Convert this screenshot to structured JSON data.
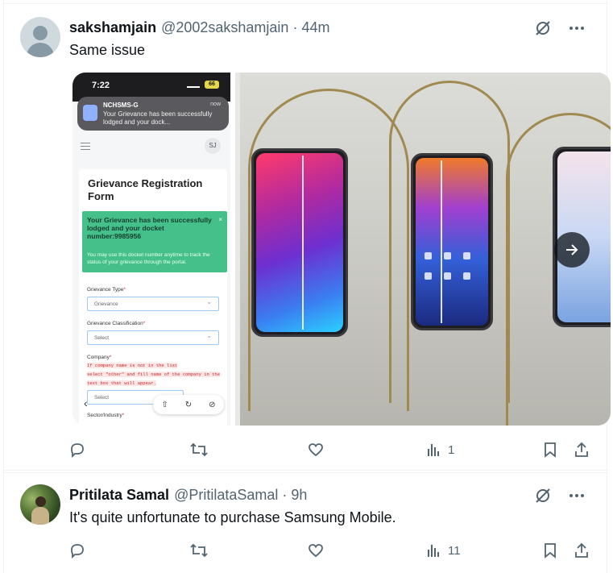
{
  "tweets": [
    {
      "display_name": "sakshamjain",
      "handle": "@2002sakshamjain",
      "separator": "·",
      "time": "44m",
      "text": "Same issue",
      "media": {
        "screenshot": {
          "clock": "7:22",
          "battery": "66",
          "notification": {
            "app": "NCHSMS-G",
            "when": "now",
            "message": "Your Grievance has been successfully lodged and your dock..."
          },
          "avatar_initials": "SJ",
          "form_title": "Grievance Registration Form",
          "success_title": "Your Grievance has been successfully lodged and your docket number:9985956",
          "success_note": "You may use this docket number anytime to track the status of your grievance through the portal.",
          "close": "×",
          "fields": [
            {
              "label": "Grievance Type",
              "value": "Grievance"
            },
            {
              "label": "Grievance Classification",
              "value": "Select"
            },
            {
              "label": "Company",
              "value": "Select"
            },
            {
              "label": "Sector/Industry",
              "value": ""
            }
          ],
          "company_hint_1": "If company name is not in the list",
          "company_hint_2": "select \"other\" and fill name of the company in the",
          "company_hint_3": "text box that will appear.",
          "required_mark": "*"
        },
        "next_icon": "arrow-right-icon"
      },
      "stats": {
        "replies": "",
        "retweets": "",
        "likes": "",
        "views": "1"
      }
    },
    {
      "display_name": "Pritilata Samal",
      "handle": "@PritilataSamal",
      "separator": "·",
      "time": "9h",
      "text": "It's quite unfortunate to purchase Samsung Mobile.",
      "stats": {
        "replies": "",
        "retweets": "",
        "likes": "",
        "views": "11"
      }
    }
  ],
  "colors": {
    "text_primary": "#0f1419",
    "text_secondary": "#536471",
    "border": "#eff3f4",
    "success_green": "#46c08a"
  }
}
